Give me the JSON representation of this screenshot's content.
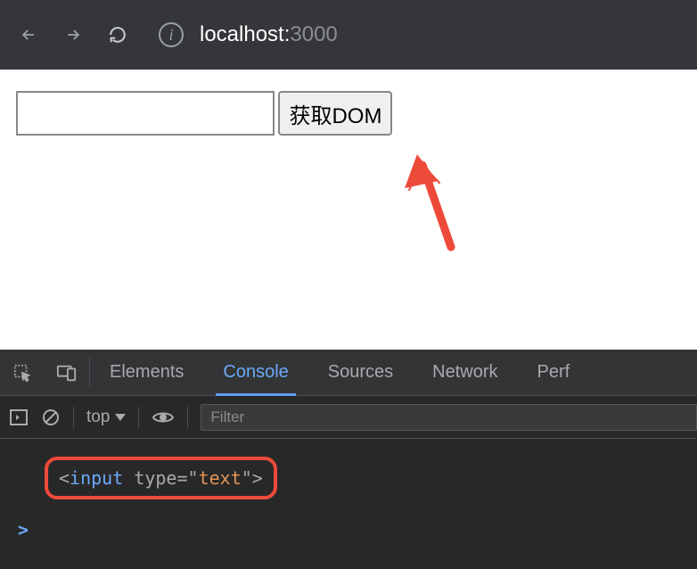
{
  "browser": {
    "url_host": "localhost:",
    "url_port": "3000"
  },
  "page": {
    "input_value": "",
    "button_label": "获取DOM"
  },
  "devtools": {
    "tabs": {
      "elements": "Elements",
      "console": "Console",
      "sources": "Sources",
      "network": "Network",
      "perf": "Perf"
    },
    "console_toolbar": {
      "context": "top",
      "filter_placeholder": "Filter"
    },
    "console_output": {
      "open": "<",
      "tag": "input",
      "space": " ",
      "attr": "type",
      "eq": "=",
      "q1": "\"",
      "val": "text",
      "q2": "\"",
      "close": ">"
    },
    "prompt": ">"
  }
}
